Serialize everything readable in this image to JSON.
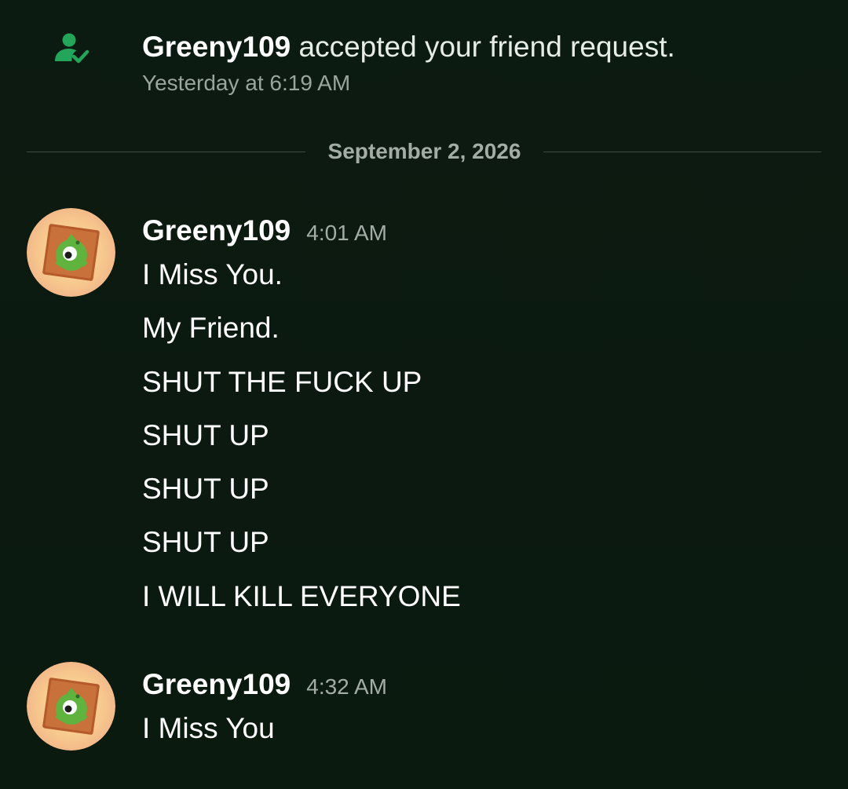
{
  "system_message": {
    "username": "Greeny109",
    "text": " accepted your friend request.",
    "time": "Yesterday at 6:19 AM",
    "icon": "friend-accepted-icon",
    "icon_color": "#23a55a"
  },
  "divider": {
    "date": "September 2, 2026"
  },
  "messages": [
    {
      "author": "Greeny109",
      "time": "4:01 AM",
      "avatar": "user-avatar",
      "lines": [
        "I Miss You.",
        "My Friend.",
        "SHUT THE FUCK UP",
        "SHUT UP",
        "SHUT UP",
        "SHUT UP",
        "I WILL KILL EVERYONE"
      ]
    },
    {
      "author": "Greeny109",
      "time": "4:32 AM",
      "avatar": "user-avatar",
      "lines": [
        "I Miss You"
      ]
    }
  ],
  "colors": {
    "background": "#0b1a10",
    "muted_text": "#a3ada6",
    "accent_green": "#23a55a"
  }
}
